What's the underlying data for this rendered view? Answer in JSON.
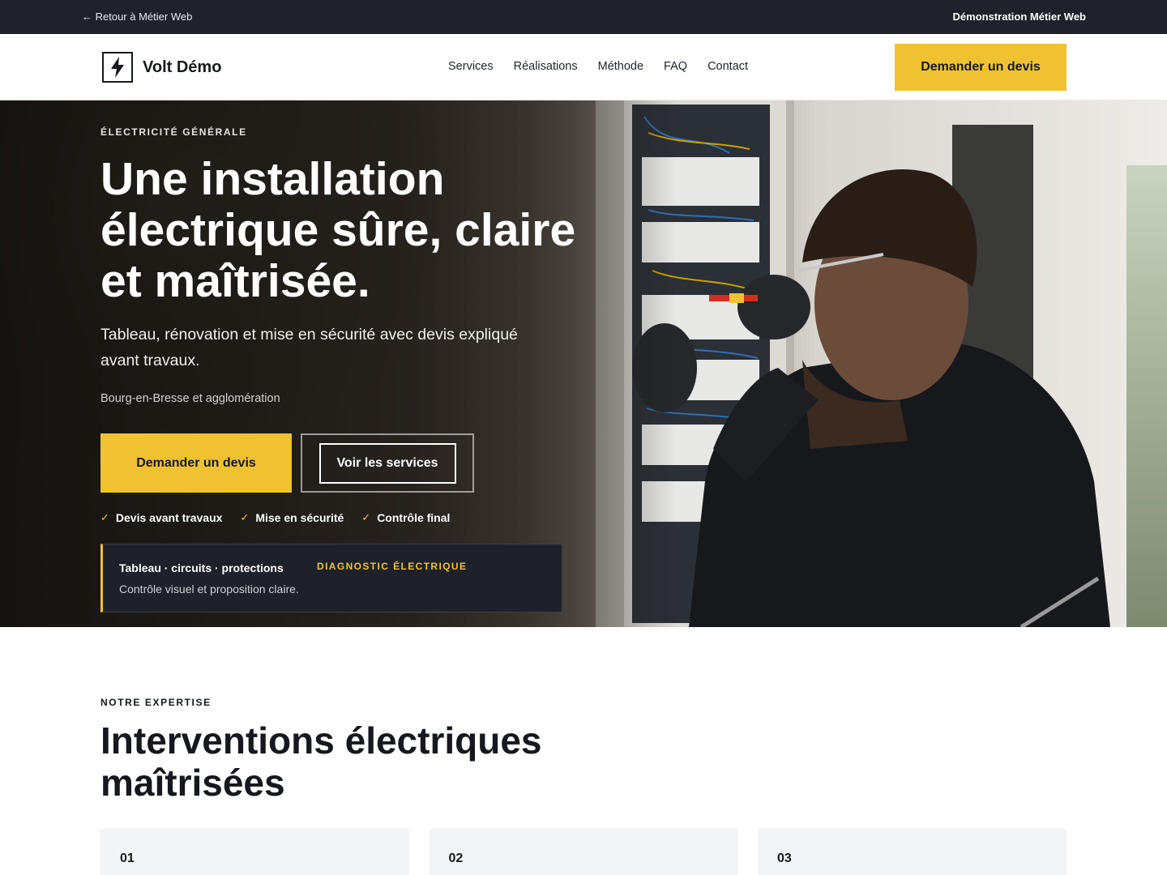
{
  "topbar": {
    "back_link": "← Retour à Métier Web",
    "demo_label": "Démonstration Métier Web"
  },
  "header": {
    "brand_name": "Volt Démo",
    "logo_icon": "lightning-bolt-icon",
    "nav": [
      {
        "label": "Services"
      },
      {
        "label": "Réalisations"
      },
      {
        "label": "Méthode"
      },
      {
        "label": "FAQ"
      },
      {
        "label": "Contact"
      }
    ],
    "cta_label": "Demander un devis"
  },
  "hero": {
    "eyebrow": "Électricité générale",
    "title": "Une installation électrique sûre, claire et maîtrisée.",
    "subtitle": "Tableau, rénovation et mise en sécurité avec devis expliqué avant travaux.",
    "location": "Bourg-en-Bresse et agglomération",
    "primary_button": "Demander un devis",
    "secondary_button": "Voir les services",
    "checks": [
      {
        "label": "Devis avant travaux"
      },
      {
        "label": "Mise en sécurité"
      },
      {
        "label": "Contrôle final"
      }
    ],
    "diag_card": {
      "title": "Tableau · circuits · protections",
      "text": "Contrôle visuel et proposition claire.",
      "tag": "Diagnostic électrique"
    }
  },
  "expertise": {
    "eyebrow": "Notre expertise",
    "title": "Interventions électriques maîtrisées",
    "cards": [
      {
        "number": "01"
      },
      {
        "number": "02"
      },
      {
        "number": "03"
      }
    ]
  },
  "colors": {
    "accent": "#f0c232",
    "dark": "#1f222b",
    "card_bg": "#f3f4f6"
  }
}
